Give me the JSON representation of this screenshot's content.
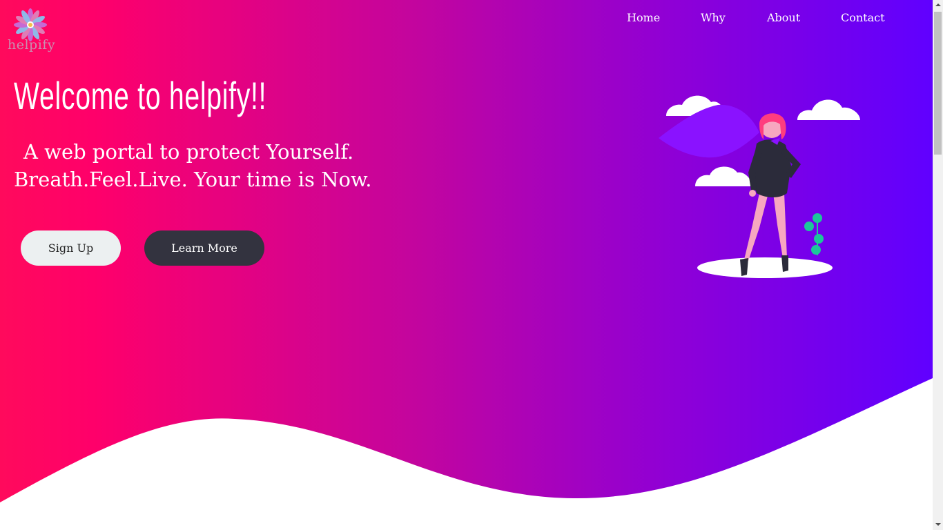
{
  "logo": {
    "text": "helpify",
    "icon": "flower-logo-icon"
  },
  "nav": {
    "items": [
      {
        "label": "Home"
      },
      {
        "label": "Why"
      },
      {
        "label": "About"
      },
      {
        "label": "Contact"
      }
    ]
  },
  "hero": {
    "title": "Welcome to helpify!!",
    "tagline_line1": "A web portal to protect Yourself.",
    "tagline_line2": "Breath.Feel.Live. Your time is Now.",
    "signup_label": "Sign Up",
    "learn_more_label": "Learn More",
    "illustration": "woman-standing-clouds-illustration"
  },
  "colors": {
    "gradient_start": "#ff0a5c",
    "gradient_end": "#6000ff",
    "signup_bg": "#ecf0f1",
    "learn_more_bg": "#33333f"
  }
}
